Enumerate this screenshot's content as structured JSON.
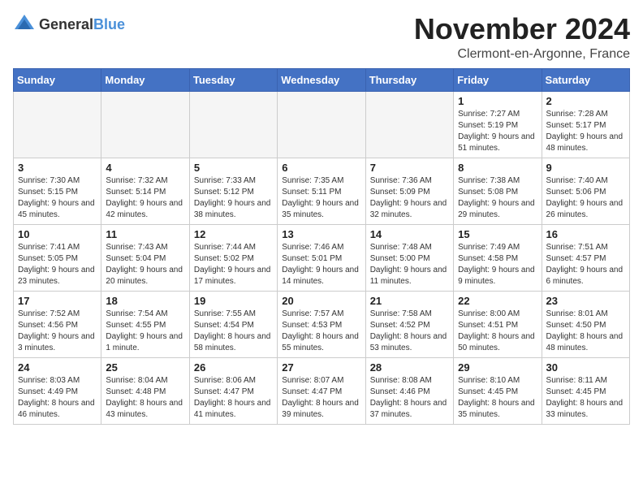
{
  "logo": {
    "text_general": "General",
    "text_blue": "Blue"
  },
  "title": {
    "month": "November 2024",
    "location": "Clermont-en-Argonne, France"
  },
  "headers": [
    "Sunday",
    "Monday",
    "Tuesday",
    "Wednesday",
    "Thursday",
    "Friday",
    "Saturday"
  ],
  "weeks": [
    [
      {
        "day": "",
        "info": ""
      },
      {
        "day": "",
        "info": ""
      },
      {
        "day": "",
        "info": ""
      },
      {
        "day": "",
        "info": ""
      },
      {
        "day": "",
        "info": ""
      },
      {
        "day": "1",
        "info": "Sunrise: 7:27 AM\nSunset: 5:19 PM\nDaylight: 9 hours and 51 minutes."
      },
      {
        "day": "2",
        "info": "Sunrise: 7:28 AM\nSunset: 5:17 PM\nDaylight: 9 hours and 48 minutes."
      }
    ],
    [
      {
        "day": "3",
        "info": "Sunrise: 7:30 AM\nSunset: 5:15 PM\nDaylight: 9 hours and 45 minutes."
      },
      {
        "day": "4",
        "info": "Sunrise: 7:32 AM\nSunset: 5:14 PM\nDaylight: 9 hours and 42 minutes."
      },
      {
        "day": "5",
        "info": "Sunrise: 7:33 AM\nSunset: 5:12 PM\nDaylight: 9 hours and 38 minutes."
      },
      {
        "day": "6",
        "info": "Sunrise: 7:35 AM\nSunset: 5:11 PM\nDaylight: 9 hours and 35 minutes."
      },
      {
        "day": "7",
        "info": "Sunrise: 7:36 AM\nSunset: 5:09 PM\nDaylight: 9 hours and 32 minutes."
      },
      {
        "day": "8",
        "info": "Sunrise: 7:38 AM\nSunset: 5:08 PM\nDaylight: 9 hours and 29 minutes."
      },
      {
        "day": "9",
        "info": "Sunrise: 7:40 AM\nSunset: 5:06 PM\nDaylight: 9 hours and 26 minutes."
      }
    ],
    [
      {
        "day": "10",
        "info": "Sunrise: 7:41 AM\nSunset: 5:05 PM\nDaylight: 9 hours and 23 minutes."
      },
      {
        "day": "11",
        "info": "Sunrise: 7:43 AM\nSunset: 5:04 PM\nDaylight: 9 hours and 20 minutes."
      },
      {
        "day": "12",
        "info": "Sunrise: 7:44 AM\nSunset: 5:02 PM\nDaylight: 9 hours and 17 minutes."
      },
      {
        "day": "13",
        "info": "Sunrise: 7:46 AM\nSunset: 5:01 PM\nDaylight: 9 hours and 14 minutes."
      },
      {
        "day": "14",
        "info": "Sunrise: 7:48 AM\nSunset: 5:00 PM\nDaylight: 9 hours and 11 minutes."
      },
      {
        "day": "15",
        "info": "Sunrise: 7:49 AM\nSunset: 4:58 PM\nDaylight: 9 hours and 9 minutes."
      },
      {
        "day": "16",
        "info": "Sunrise: 7:51 AM\nSunset: 4:57 PM\nDaylight: 9 hours and 6 minutes."
      }
    ],
    [
      {
        "day": "17",
        "info": "Sunrise: 7:52 AM\nSunset: 4:56 PM\nDaylight: 9 hours and 3 minutes."
      },
      {
        "day": "18",
        "info": "Sunrise: 7:54 AM\nSunset: 4:55 PM\nDaylight: 9 hours and 1 minute."
      },
      {
        "day": "19",
        "info": "Sunrise: 7:55 AM\nSunset: 4:54 PM\nDaylight: 8 hours and 58 minutes."
      },
      {
        "day": "20",
        "info": "Sunrise: 7:57 AM\nSunset: 4:53 PM\nDaylight: 8 hours and 55 minutes."
      },
      {
        "day": "21",
        "info": "Sunrise: 7:58 AM\nSunset: 4:52 PM\nDaylight: 8 hours and 53 minutes."
      },
      {
        "day": "22",
        "info": "Sunrise: 8:00 AM\nSunset: 4:51 PM\nDaylight: 8 hours and 50 minutes."
      },
      {
        "day": "23",
        "info": "Sunrise: 8:01 AM\nSunset: 4:50 PM\nDaylight: 8 hours and 48 minutes."
      }
    ],
    [
      {
        "day": "24",
        "info": "Sunrise: 8:03 AM\nSunset: 4:49 PM\nDaylight: 8 hours and 46 minutes."
      },
      {
        "day": "25",
        "info": "Sunrise: 8:04 AM\nSunset: 4:48 PM\nDaylight: 8 hours and 43 minutes."
      },
      {
        "day": "26",
        "info": "Sunrise: 8:06 AM\nSunset: 4:47 PM\nDaylight: 8 hours and 41 minutes."
      },
      {
        "day": "27",
        "info": "Sunrise: 8:07 AM\nSunset: 4:47 PM\nDaylight: 8 hours and 39 minutes."
      },
      {
        "day": "28",
        "info": "Sunrise: 8:08 AM\nSunset: 4:46 PM\nDaylight: 8 hours and 37 minutes."
      },
      {
        "day": "29",
        "info": "Sunrise: 8:10 AM\nSunset: 4:45 PM\nDaylight: 8 hours and 35 minutes."
      },
      {
        "day": "30",
        "info": "Sunrise: 8:11 AM\nSunset: 4:45 PM\nDaylight: 8 hours and 33 minutes."
      }
    ]
  ]
}
